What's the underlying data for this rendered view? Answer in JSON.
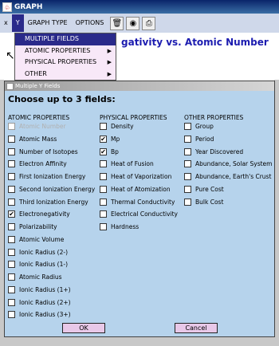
{
  "window": {
    "title": "GRAPH"
  },
  "menubar": {
    "close_glyph": "x",
    "items": [
      "Y",
      "GRAPH TYPE",
      "OPTIONS"
    ]
  },
  "toolbar": {
    "icons": [
      "trash-icon",
      "find-icon",
      "print-icon"
    ]
  },
  "graph": {
    "heading": "gativity vs. Atomic Number"
  },
  "dropdown": {
    "items": [
      {
        "label": "MULTIPLE FIELDS",
        "has_submenu": false,
        "selected": true
      },
      {
        "label": "ATOMIC PROPERTIES",
        "has_submenu": true,
        "selected": false
      },
      {
        "label": "PHYSICAL PROPERTIES",
        "has_submenu": true,
        "selected": false
      },
      {
        "label": "OTHER",
        "has_submenu": true,
        "selected": false
      }
    ]
  },
  "dialog": {
    "title": "Multiple Y Fields",
    "heading": "Choose up to 3 fields:",
    "columns": [
      {
        "header": "ATOMIC PROPERTIES",
        "items": [
          {
            "label": "Atomic Number",
            "checked": false,
            "disabled": true
          },
          {
            "label": "Atomic Mass",
            "checked": false,
            "disabled": false
          },
          {
            "label": "Number of Isotopes",
            "checked": false,
            "disabled": false
          },
          {
            "label": "Electron Affinity",
            "checked": false,
            "disabled": false
          },
          {
            "label": "First Ionization Energy",
            "checked": false,
            "disabled": false
          },
          {
            "label": "Second Ionization Energy",
            "checked": false,
            "disabled": false
          },
          {
            "label": "Third Ionization Energy",
            "checked": false,
            "disabled": false
          },
          {
            "label": "Electronegativity",
            "checked": true,
            "disabled": false
          },
          {
            "label": "Polarizability",
            "checked": false,
            "disabled": false
          },
          {
            "label": "Atomic Volume",
            "checked": false,
            "disabled": false
          },
          {
            "label": "Ionic Radius (2-)",
            "checked": false,
            "disabled": false
          },
          {
            "label": "Ionic Radius (1-)",
            "checked": false,
            "disabled": false
          },
          {
            "label": "Atomic Radius",
            "checked": false,
            "disabled": false
          },
          {
            "label": "Ionic Radius (1+)",
            "checked": false,
            "disabled": false
          },
          {
            "label": "Ionic Radius (2+)",
            "checked": false,
            "disabled": false
          },
          {
            "label": "Ionic Radius (3+)",
            "checked": false,
            "disabled": false
          }
        ]
      },
      {
        "header": "PHYSICAL PROPERTIES",
        "items": [
          {
            "label": "Density",
            "checked": false,
            "disabled": false
          },
          {
            "label": "Mp",
            "checked": true,
            "disabled": false
          },
          {
            "label": "Bp",
            "checked": true,
            "disabled": false
          },
          {
            "label": "Heat of Fusion",
            "checked": false,
            "disabled": false
          },
          {
            "label": "Heat of Vaporization",
            "checked": false,
            "disabled": false
          },
          {
            "label": "Heat of Atomization",
            "checked": false,
            "disabled": false
          },
          {
            "label": "Thermal Conductivity",
            "checked": false,
            "disabled": false
          },
          {
            "label": "Electrical Conductivity",
            "checked": false,
            "disabled": false
          },
          {
            "label": "Hardness",
            "checked": false,
            "disabled": false
          }
        ]
      },
      {
        "header": "OTHER PROPERTIES",
        "items": [
          {
            "label": "Group",
            "checked": false,
            "disabled": false
          },
          {
            "label": "Period",
            "checked": false,
            "disabled": false
          },
          {
            "label": "Year Discovered",
            "checked": false,
            "disabled": false
          },
          {
            "label": "Abundance, Solar System",
            "checked": false,
            "disabled": false
          },
          {
            "label": "Abundance, Earth's Crust",
            "checked": false,
            "disabled": false
          },
          {
            "label": "Pure Cost",
            "checked": false,
            "disabled": false
          },
          {
            "label": "Bulk Cost",
            "checked": false,
            "disabled": false
          }
        ]
      }
    ],
    "ok_label": "OK",
    "cancel_label": "Cancel"
  },
  "colors": {
    "menu_selected": "#2a2a8a",
    "dialog_bg": "#b6d3ec",
    "heading": "#1c1cb0",
    "dropdown_bg": "#f8e8f8",
    "button_bg": "#e8c8e8"
  }
}
